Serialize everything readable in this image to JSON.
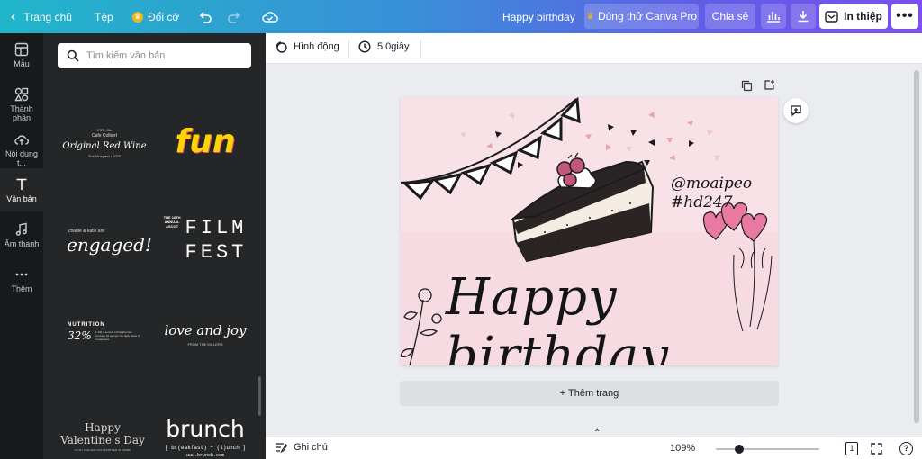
{
  "topbar": {
    "home_label": "Trang chủ",
    "file_label": "Tệp",
    "resize_label": "Đổi cỡ",
    "design_title": "Happy birthday",
    "try_pro_label": "Dùng thử Canva Pro",
    "share_label": "Chia sẻ",
    "print_label": "In thiệp"
  },
  "rail": {
    "items": [
      {
        "label": "Mẫu",
        "icon": "template-icon"
      },
      {
        "label": "Thành phần",
        "icon": "elements-icon"
      },
      {
        "label": "Nội dung t...",
        "icon": "upload-cloud-icon"
      },
      {
        "label": "Văn bản",
        "icon": "text-icon"
      },
      {
        "label": "Âm thanh",
        "icon": "music-icon"
      },
      {
        "label": "Thêm",
        "icon": "more-icon"
      }
    ]
  },
  "panel": {
    "search_placeholder": "Tìm kiếm văn bản",
    "tiles": {
      "wine": {
        "small1": "EST. 40s",
        "small2": "Cafe Colbert",
        "main": "Original Red Wine",
        "small3": "The Vineyard • 2020"
      },
      "fun": {
        "main": "fun"
      },
      "engaged": {
        "small": "charlie & katie are",
        "main": "engaged!"
      },
      "film": {
        "small1": "THE 16TH",
        "small2": "ANNUAL",
        "small3": "ASCOT",
        "main1": "FILM",
        "main2": "FEST"
      },
      "nutrition": {
        "title": "NUTRITION",
        "value": "32%",
        "desc": "A 100 g serving of blackberries provides 32 percent the daily value of manganese"
      },
      "love": {
        "main": "love and joy",
        "small": "FROM THE MILLERS"
      },
      "valentine": {
        "main1": "Happy",
        "main2": "Valentine's Day",
        "small": "TO MY ONE AND ONLY PARTNER IN CRIME!"
      },
      "brunch": {
        "main": "brunch",
        "sub": "[ br(eakfast) + (l)unch ]",
        "url": "www.brunch.com"
      }
    }
  },
  "toolbar": {
    "animate_label": "Hình động",
    "duration_label": "5.0giây"
  },
  "card": {
    "greeting": "Happy birthday",
    "handle": "@moaipeo",
    "hashtag": "#hd247"
  },
  "add_page_label": "+ Thêm trang",
  "bottombar": {
    "notes_label": "Ghi chú",
    "zoom_label": "109%",
    "zoom_fraction": 0.2,
    "page_count": "1"
  },
  "colors": {
    "accent_gradient_start": "#20b6c9",
    "accent_gradient_end": "#7b4ff0",
    "fun_yellow": "#ffd500",
    "card_pink": "#f7dbe3",
    "balloon_pink": "#e87aa2"
  }
}
